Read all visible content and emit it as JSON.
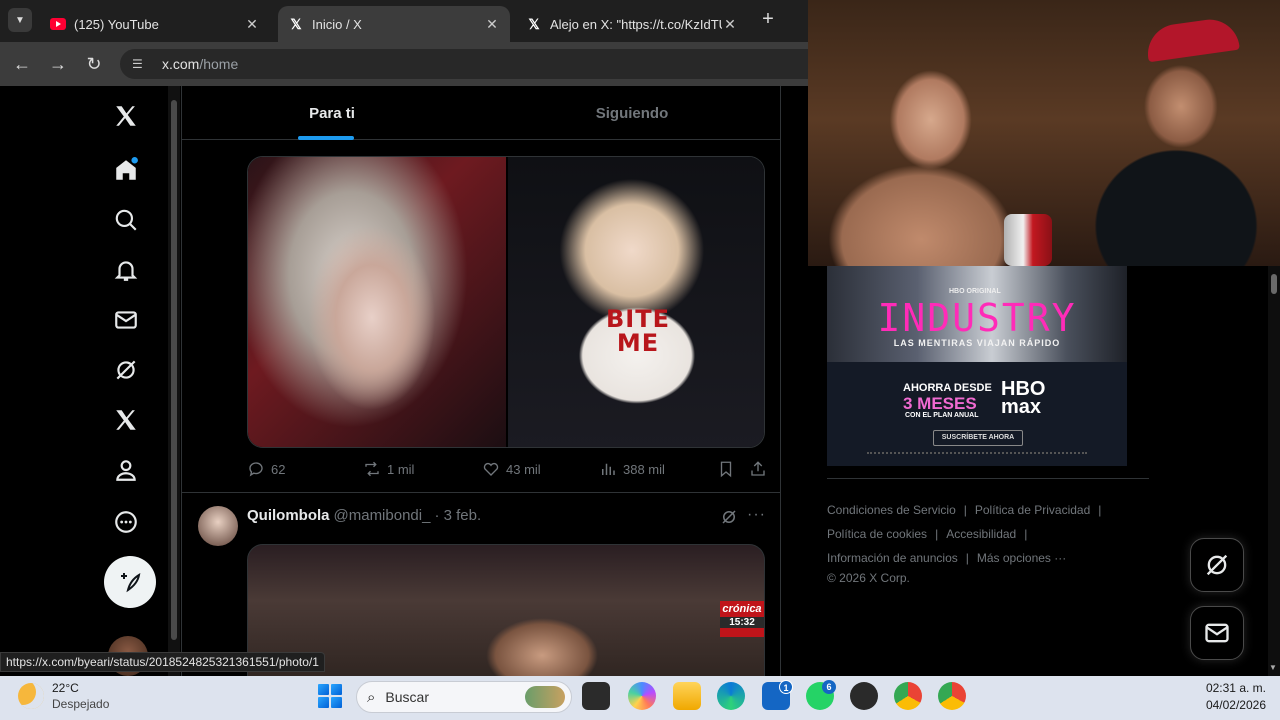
{
  "browser": {
    "tabs": [
      {
        "title": "(125) YouTube",
        "active": false
      },
      {
        "title": "Inicio / X",
        "active": true
      },
      {
        "title": "Alejo en X: \"https://t.co/KzIdTU",
        "active": false
      }
    ],
    "url_host": "x.com",
    "url_path": "/home",
    "status_url": "https://x.com/byeari/status/2018524825321361551/photo/1"
  },
  "timeline": {
    "tabs": [
      "Para ti",
      "Siguiendo"
    ],
    "tweet1": {
      "photo_text": "BITE\nME",
      "replies": "62",
      "reposts": "1 mil",
      "likes": "43 mil",
      "views": "388 mil"
    },
    "tweet2": {
      "name": "Quilombola",
      "handle": "@mamibondi_",
      "date": "· 3 feb.",
      "more": "···",
      "overlay_brand": "crónica",
      "overlay_time": "15:32"
    }
  },
  "ad": {
    "network": "HBO ORIGINAL",
    "title": "INDUSTRY",
    "tagline": "LAS MENTIRAS VIAJAN RÁPIDO",
    "offer_line1": "AHORRA DESDE",
    "offer_line2": "3 MESES",
    "offer_line3": "CON EL PLAN ANUAL",
    "brand": "HBO\nmax",
    "cta": "SUSCRÍBETE AHORA"
  },
  "footer": {
    "links_row1": [
      "Condiciones de Servicio",
      "Política de Privacidad"
    ],
    "links_row2": [
      "Política de cookies",
      "Accesibilidad"
    ],
    "links_row3": [
      "Información de anuncios",
      "Más opciones ···"
    ],
    "copyright": "© 2026 X Corp."
  },
  "taskbar": {
    "temperature": "22°C",
    "condition": "Despejado",
    "search_placeholder": "Buscar",
    "time": "02:31 a. m.",
    "date": "04/02/2026",
    "badge_store": "1",
    "badge_whatsapp": "6"
  },
  "icons": {
    "home": "home-icon",
    "explore": "search-icon",
    "notifications": "bell-icon",
    "messages": "mail-icon",
    "grok": "grok-icon",
    "premium": "x-icon",
    "profile": "person-icon",
    "more": "more-circle-icon"
  },
  "colors": {
    "accent": "#1d9bf0",
    "ad_title": "#ff2bb8"
  }
}
